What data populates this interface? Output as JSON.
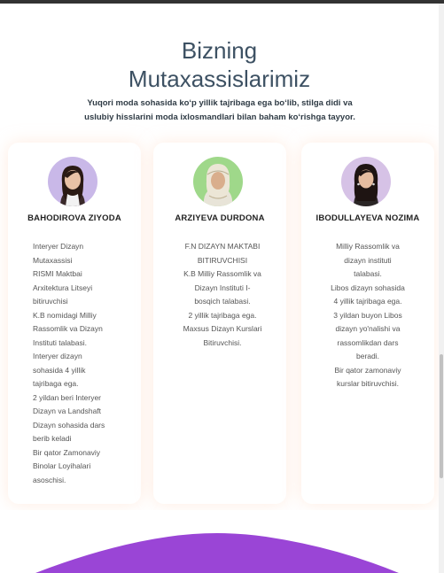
{
  "section": {
    "title_line1": "Bizning",
    "title_line2": "Mutaxassislarimiz",
    "subtitle_line1": "Yuqori moda sohasida ko‘p yillik tajribaga ega bo‘lib, stilga didi va",
    "subtitle_line2": "uslubiy hisslarini moda ixlosmandlari bilan baham ko‘rishga tayyor."
  },
  "cards": [
    {
      "name": "BAHODIROVA ZIYODA",
      "bio": [
        "Interyer Dizayn",
        "Mutaxassisi",
        "RISMI Maktbai",
        "Arxitektura Litseyi",
        "bitiruvchisi",
        "K.B nomidagi Milliy",
        "Rassomlik va Dizayn",
        "Instituti talabasi.",
        "Interyer dizayn",
        "sohasida 4 yillik",
        "tajribaga ega.",
        "2 yildan beri Interyer",
        "Dizayn va Landshaft",
        "Dizayn sohasida dars",
        "berib keladi",
        "Bir qator Zamonaviy",
        "Binolar Loyihalari",
        "asoschisi."
      ]
    },
    {
      "name": "ARZIYEVA DURDONA",
      "bio": [
        "F.N DIZAYN MAKTABI",
        "BITIRUVCHISI",
        "K.B Milliy Rassomlik va",
        "Dizayn Instituti I-",
        "bosqich talabasi.",
        "2 yillik tajribaga ega.",
        "Maxsus Dizayn Kurslari",
        "Bitiruvchisi."
      ]
    },
    {
      "name": "IBODULLAYEVA NOZIMA",
      "bio": [
        "Milliy Rassomlik va",
        "dizayn instituti",
        "talabasi.",
        "Libos dizayn sohasida",
        "4 yillik tajribaga ega.",
        "3 yildan buyon Libos",
        "dizayn yo'nalishi va",
        "rassomlikdan dars",
        "beradi.",
        "Bir qator zamonaviy",
        "kurslar bitiruvchisi."
      ]
    }
  ],
  "colors": {
    "heading": "#3d5163",
    "accent_purple": "#9a45d6",
    "card_glow": "#ffdcc8"
  },
  "icons": {
    "avatar1": "portrait-photo",
    "avatar2": "portrait-photo",
    "avatar3": "portrait-photo"
  }
}
